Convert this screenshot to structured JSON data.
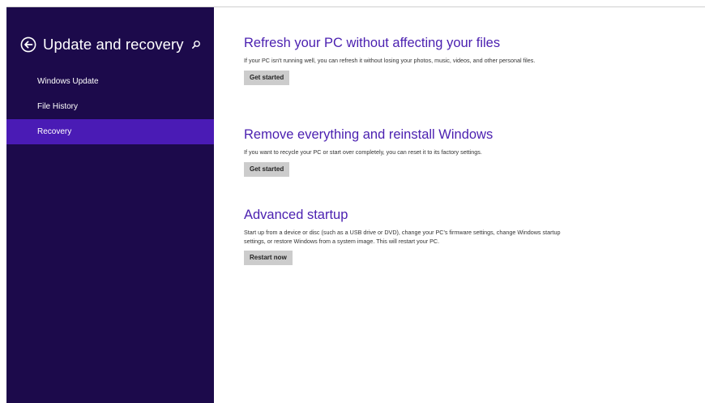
{
  "sidebar": {
    "title": "Update and recovery",
    "items": [
      {
        "label": "Windows Update",
        "selected": false
      },
      {
        "label": "File History",
        "selected": false
      },
      {
        "label": "Recovery",
        "selected": true
      }
    ],
    "back_icon": "back-arrow-circle-icon",
    "search_icon": "search-icon"
  },
  "main": {
    "sections": [
      {
        "title": "Refresh your PC without affecting your files",
        "description": "If your PC isn't running well, you can refresh it without losing your photos, music, videos, and other personal files.",
        "button": "Get started"
      },
      {
        "title": "Remove everything and reinstall Windows",
        "description": "If you want to recycle your PC or start over completely, you can reset it to its factory settings.",
        "button": "Get started"
      },
      {
        "title": "Advanced startup",
        "description": "Start up from a device or disc (such as a USB drive or DVD), change your PC's firmware settings, change Windows startup settings, or restore Windows from a system image. This will restart your PC.",
        "button": "Restart now"
      }
    ]
  },
  "colors": {
    "sidebar_bg": "#1c0a4b",
    "selected_bg": "#4a1bb5",
    "heading": "#4a1fb0",
    "button_bg": "#cccccc"
  }
}
